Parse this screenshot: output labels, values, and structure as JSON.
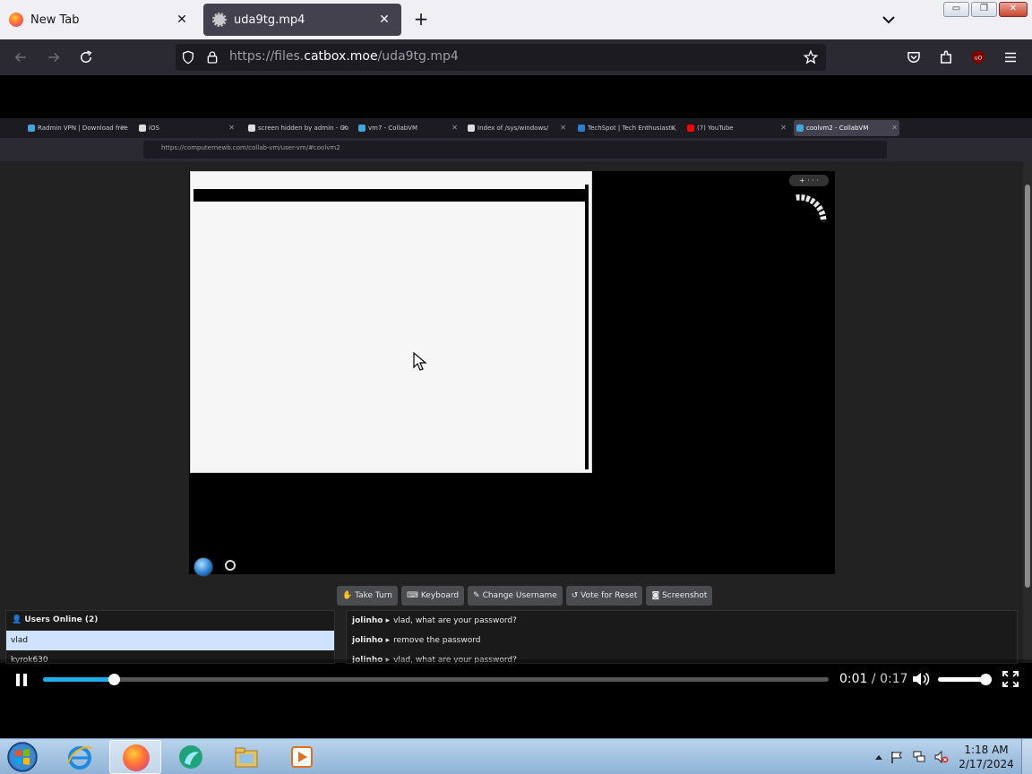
{
  "browser": {
    "tabs": [
      {
        "title": "New Tab",
        "icon": "firefox-icon",
        "active": false
      },
      {
        "title": "uda9tg.mp4",
        "icon": "file-icon",
        "active": true
      }
    ],
    "close_glyph": "✕",
    "newtab_glyph": "+",
    "url_prefix": "https://files.",
    "url_host": "catbox.moe",
    "url_path": "/uda9tg.mp4",
    "window_controls": [
      "▭",
      "❐",
      "✕"
    ]
  },
  "video": {
    "current_time": "0:01",
    "separator": " / ",
    "duration": "0:17",
    "progress": 0.09,
    "volume": 0.98,
    "accent_color": "#22aee8"
  },
  "inner_browser": {
    "tabs": [
      {
        "title": "Radmin VPN | Download free",
        "color": "#3fa7e0",
        "selected": false
      },
      {
        "title": "iOS",
        "color": "#dddddd",
        "selected": false
      },
      {
        "title": "screen hidden by admin - Go",
        "color": "#dddddd",
        "selected": false
      },
      {
        "title": "vm7 - CollabVM",
        "color": "#3fa7e0",
        "selected": false
      },
      {
        "title": "Index of /sys/windows/",
        "color": "#dddddd",
        "selected": false
      },
      {
        "title": "TechSpot | Tech Enthusiasts, P",
        "color": "#2a7fd1",
        "selected": false
      },
      {
        "title": "(7) YouTube",
        "color": "#ff0000",
        "selected": false
      },
      {
        "title": "coolvm2 - CollabVM",
        "color": "#3fa7e0",
        "selected": true
      }
    ],
    "url": "https://computernewb.com/collab-vm/user-vm/#coolvm2",
    "vm_buttons": [
      "Take Turn",
      "Keyboard",
      "Change Username",
      "Vote for Reset",
      "Screenshot"
    ],
    "users_header": "Users Online (2)",
    "users": [
      "vlad",
      "kyrok630"
    ],
    "chat": [
      {
        "user": "jolinho ▸",
        "text": "vlad, what are your password?"
      },
      {
        "user": "jolinho ▸",
        "text": "remove the password"
      },
      {
        "user": "jolinho ▸",
        "text": "vlad, what are your password?"
      }
    ]
  },
  "taskbar": {
    "time": "1:18 AM",
    "date": "2/17/2024",
    "apps": [
      "internet-explorer-icon",
      "firefox-icon",
      "radmin-icon",
      "file-explorer-icon",
      "media-player-icon"
    ]
  }
}
